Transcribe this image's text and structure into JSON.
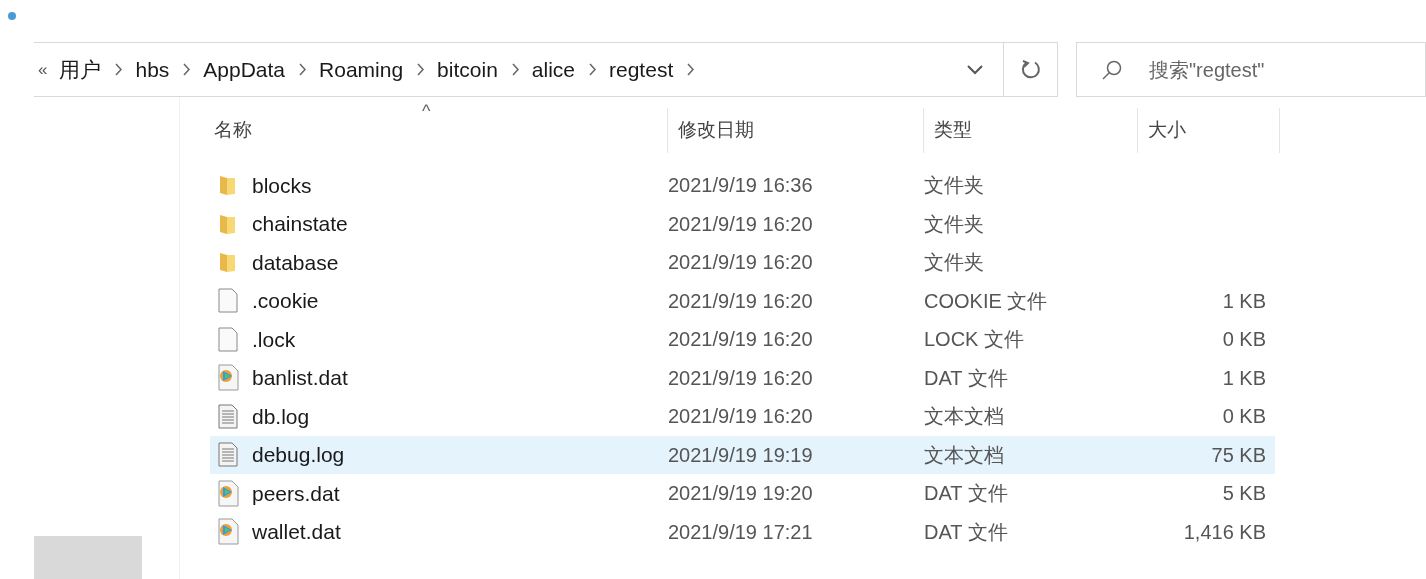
{
  "address_bar": {
    "overflow": "«",
    "path": [
      "用户",
      "hbs",
      "AppData",
      "Roaming",
      "bitcoin",
      "alice",
      "regtest"
    ]
  },
  "search": {
    "placeholder": "搜索\"regtest\""
  },
  "table": {
    "sort_indicator": "^",
    "columns": [
      "名称",
      "修改日期",
      "类型",
      "大小"
    ],
    "rows": [
      {
        "kind": "folder",
        "name": "blocks",
        "date": "2021/9/19 16:36",
        "type": "文件夹",
        "size": "",
        "selected": false
      },
      {
        "kind": "folder",
        "name": "chainstate",
        "date": "2021/9/19 16:20",
        "type": "文件夹",
        "size": "",
        "selected": false
      },
      {
        "kind": "folder",
        "name": "database",
        "date": "2021/9/19 16:20",
        "type": "文件夹",
        "size": "",
        "selected": false
      },
      {
        "kind": "blank",
        "name": ".cookie",
        "date": "2021/9/19 16:20",
        "type": "COOKIE 文件",
        "size": "1 KB",
        "selected": false
      },
      {
        "kind": "blank",
        "name": ".lock",
        "date": "2021/9/19 16:20",
        "type": "LOCK 文件",
        "size": "0 KB",
        "selected": false
      },
      {
        "kind": "media",
        "name": "banlist.dat",
        "date": "2021/9/19 16:20",
        "type": "DAT 文件",
        "size": "1 KB",
        "selected": false
      },
      {
        "kind": "text",
        "name": "db.log",
        "date": "2021/9/19 16:20",
        "type": "文本文档",
        "size": "0 KB",
        "selected": false
      },
      {
        "kind": "text",
        "name": "debug.log",
        "date": "2021/9/19 19:19",
        "type": "文本文档",
        "size": "75 KB",
        "selected": true
      },
      {
        "kind": "media",
        "name": "peers.dat",
        "date": "2021/9/19 19:20",
        "type": "DAT 文件",
        "size": "5 KB",
        "selected": false
      },
      {
        "kind": "media",
        "name": "wallet.dat",
        "date": "2021/9/19 17:21",
        "type": "DAT 文件",
        "size": "1,416 KB",
        "selected": false
      }
    ]
  }
}
